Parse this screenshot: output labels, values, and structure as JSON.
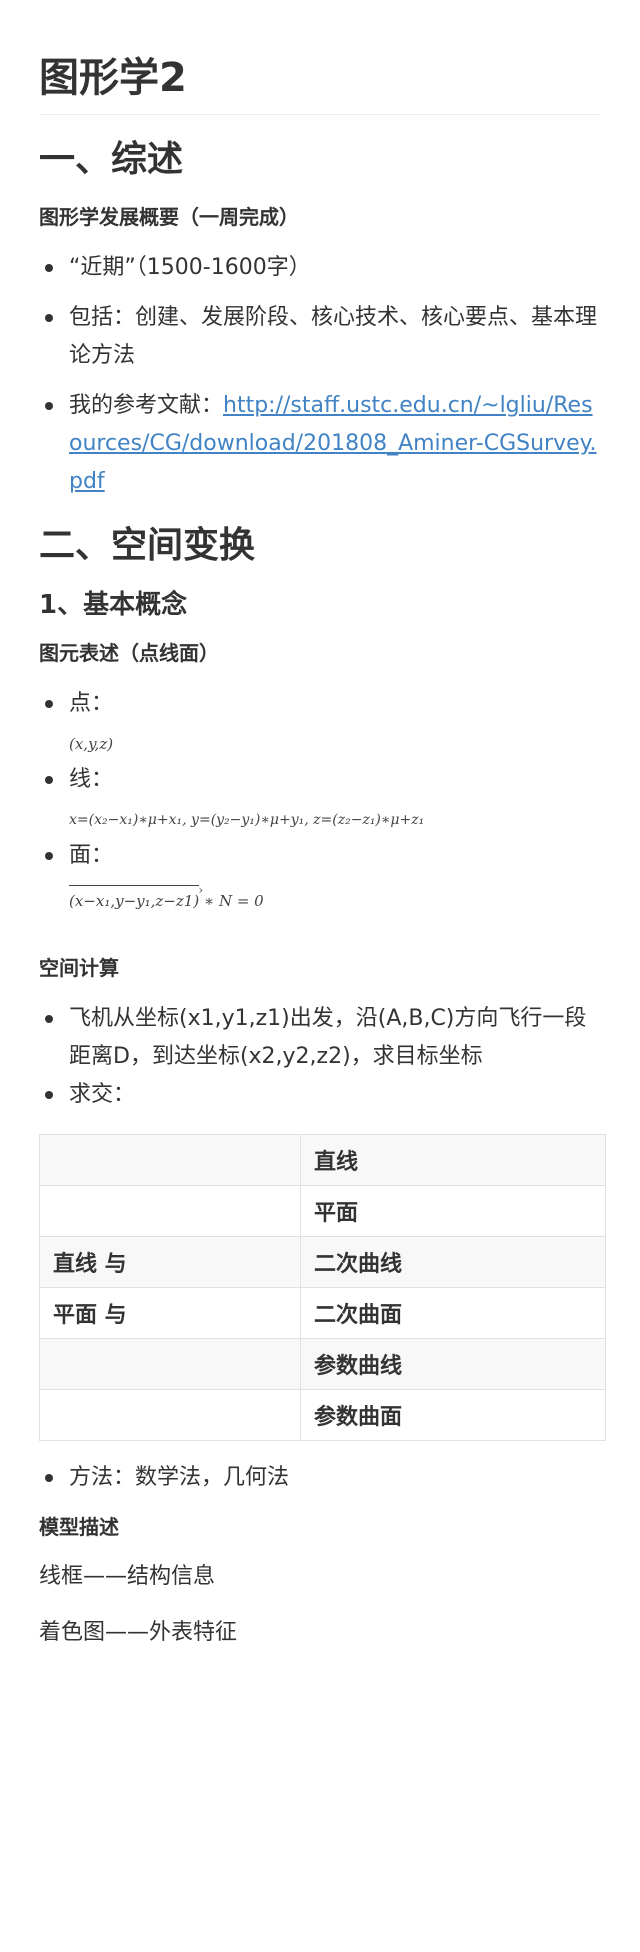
{
  "title": "图形学2",
  "section1": {
    "heading": "一、综述",
    "subheading": "图形学发展概要（一周完成）",
    "items": [
      "“近期”（1500-1600字）",
      "包括：创建、发展阶段、核心技术、核心要点、基本理论方法"
    ],
    "ref_label": "我的参考文献：",
    "ref_link": "http://staff.ustc.edu.cn/~lgliu/Resources/CG/download/201808_Aminer-CGSurvey.pdf"
  },
  "section2": {
    "heading": "二、空间变换",
    "sub1": "1、基本概念",
    "primitives_heading": "图元表述（点线面）",
    "point_label": "点：",
    "point_formula": "(x,y,z)",
    "line_label": "线：",
    "line_formula": "x=(x₂−x₁)∗μ+x₁, y=(y₂−y₁)∗μ+y₁, z=(z₂−z₁)∗μ+z₁",
    "plane_label": "面：",
    "plane_formula_vec": "(x−x₁,y−y₁,z−z1)",
    "plane_formula_rest": "∗ N = 0",
    "calc_heading": "空间计算",
    "calc_items": [
      "飞机从坐标(x1,y1,z1)出发，沿(A,B,C)方向飞行一段距离D，到达坐标(x2,y2,z2)，求目标坐标",
      "求交："
    ],
    "table": [
      [
        "",
        "直线"
      ],
      [
        "",
        "平面"
      ],
      [
        "直线 与",
        "二次曲线"
      ],
      [
        "平面 与",
        "二次曲面"
      ],
      [
        "",
        "参数曲线"
      ],
      [
        "",
        "参数曲面"
      ]
    ],
    "method": "方法：数学法，几何法",
    "model_heading": "模型描述",
    "model_lines": [
      "线框——结构信息",
      "着色图——外表特征"
    ]
  }
}
